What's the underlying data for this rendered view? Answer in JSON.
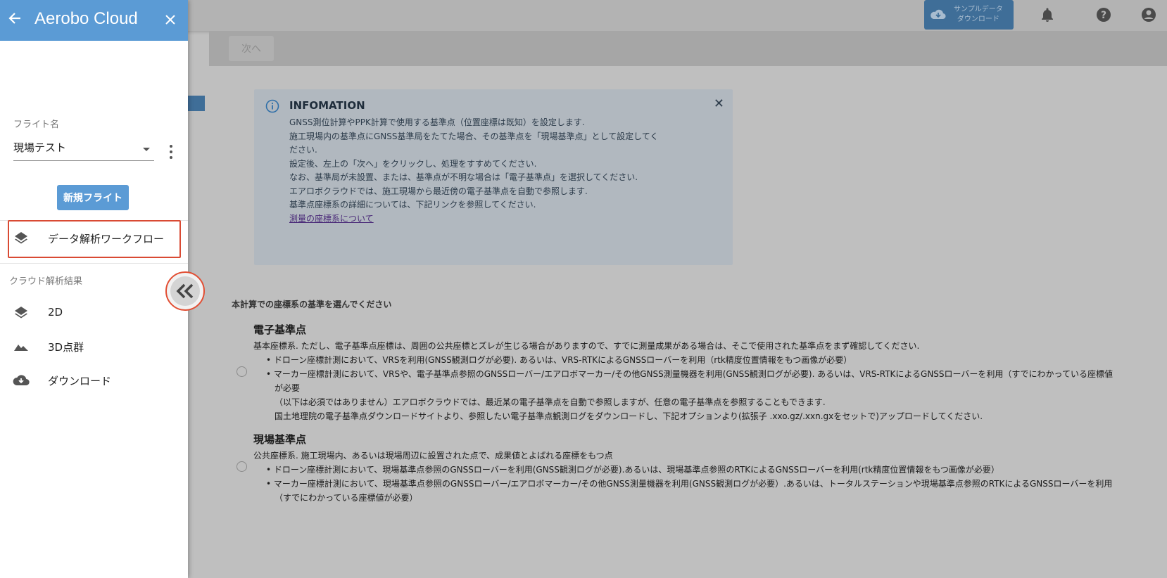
{
  "topbar": {
    "sample_line1": "サンプルデータ",
    "sample_line2": "ダウンロード",
    "icons": [
      "cloud-download-icon",
      "bell-icon",
      "help-icon",
      "account-icon"
    ]
  },
  "main": {
    "next_label": "次へ",
    "info": {
      "title": "INFOMATION",
      "lines": [
        "GNSS測位計算やPPK計算で使用する基準点（位置座標は既知）を設定します.",
        "施工現場内の基準点にGNSS基準局をたてた場合、その基準点を「現場基準点」として設定してく",
        "ださい.",
        "設定後、左上の「次へ」をクリックし、処理をすすめてください.",
        "",
        "なお、基準局が未設置、または、基準点が不明な場合は「電子基準点」を選択してください.",
        "エアロボクラウドでは、施工現場から最近傍の電子基準点を自動で参照します.",
        "",
        "基準点座標系の詳細については、下記リンクを参照してください."
      ],
      "link": "測量の座標系について"
    },
    "question": "本計算での座標系の基準を選んでください",
    "option1": {
      "title": "電子基準点",
      "desc": "基本座標系. ただし、電子基準点座標は、周囲の公共座標とズレが生じる場合がありますので、すでに測量成果がある場合は、そこで使用された基準点をまず確認してください.",
      "bullet1": "• ドローン座標計測において、VRSを利用(GNSS観測ログが必要). あるいは、VRS-RTKによるGNSSローバーを利用（rtk精度位置情報をもつ画像が必要）",
      "bullet2": "• マーカー座標計測において、VRSや、電子基準点参照のGNSSローバー/エアロボマーカー/その他GNSS測量機器を利用(GNSS観測ログが必要). あるいは、VRS-RTKによるGNSSローバーを利用（すでにわかっている座標値",
      "bullet2_cont": "が必要",
      "note1": "（以下は必須ではありません）エアロボクラウドでは、最近某の電子基準点を自動で参照しますが、任意の電子基準点を参照することもできます.",
      "note2": "国土地理院の電子基準点ダウンロードサイトより、参照したい電子基準点観測ログをダウンロードし、下記オプションより(拡張子 .xxo.gz/.xxn.gxをセットで)アップロードしてください."
    },
    "option2": {
      "title": "現場基準点",
      "desc": "公共座標系. 施工現場内、あるいは現場周辺に設置された点で、成果値とよばれる座標をもつ点",
      "bullet1": "• ドローン座標計測において、現場基準点参照のGNSSローバーを利用(GNSS観測ログが必要).あるいは、現場基準点参照のRTKによるGNSSローバーを利用(rtk精度位置情報をもつ画像が必要）",
      "bullet2": "• マーカー座標計測において、現場基準点参照のGNSSローバー/エアロボマーカー/その他GNSS測量機器を利用(GNSS観測ログが必要）.あるいは、トータルステーションや現場基準点参照のRTKによるGNSSローバーを利用",
      "bullet2_cont": "（すでにわかっている座標値が必要）"
    }
  },
  "sidebar": {
    "title": "Aerobo Cloud",
    "flight_label": "フライト名",
    "flight_value": "現場テスト",
    "new_flight": "新規フライト",
    "workflow": "データ解析ワークフロー",
    "section_label": "クラウド解析結果",
    "items": [
      {
        "label": "2D",
        "icon": "layers-icon"
      },
      {
        "label": "3D点群",
        "icon": "terrain-icon"
      },
      {
        "label": "ダウンロード",
        "icon": "cloud-download-icon"
      }
    ]
  },
  "colors": {
    "accent": "#5b9bd5",
    "highlight": "#d94a33"
  }
}
